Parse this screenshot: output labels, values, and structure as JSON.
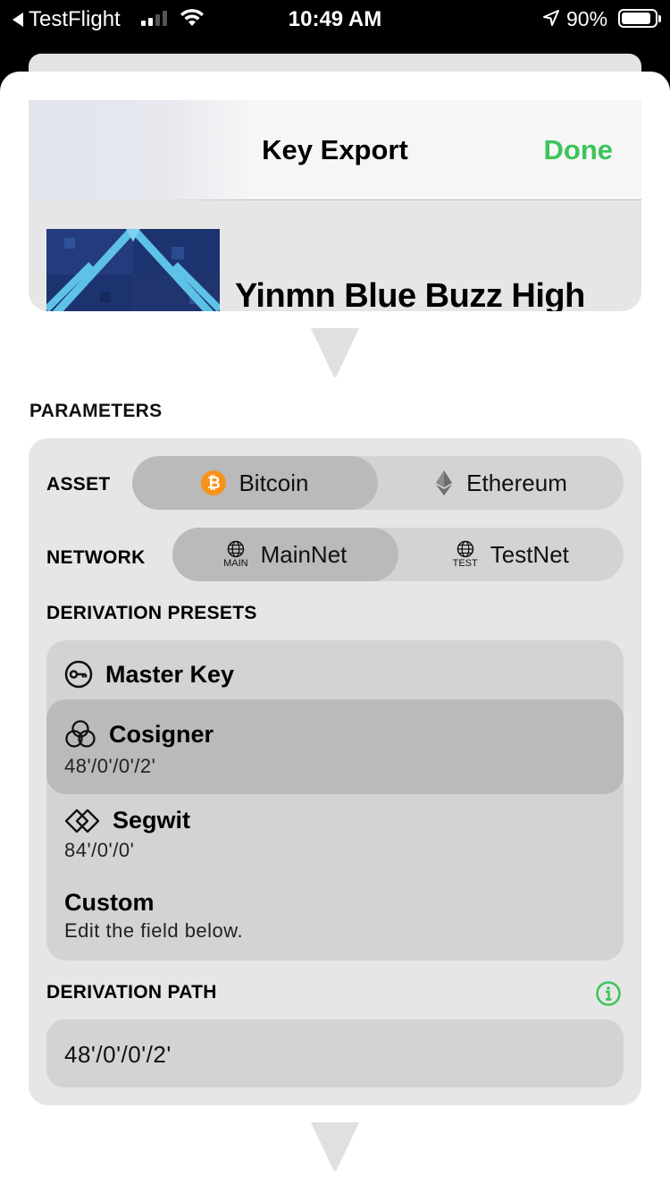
{
  "status_bar": {
    "back_app": "TestFlight",
    "time": "10:49 AM",
    "battery": "90%"
  },
  "nav": {
    "title": "Key Export",
    "done": "Done"
  },
  "key": {
    "name": "Yinmn Blue Buzz High"
  },
  "parameters": {
    "heading": "PARAMETERS",
    "asset": {
      "label": "ASSET",
      "options": [
        "Bitcoin",
        "Ethereum"
      ],
      "selected": "Bitcoin"
    },
    "network": {
      "label": "NETWORK",
      "options": [
        {
          "label": "MainNet",
          "caption": "MAIN"
        },
        {
          "label": "TestNet",
          "caption": "TEST"
        }
      ],
      "selected": "MainNet"
    },
    "presets": {
      "label": "DERIVATION PRESETS",
      "items": [
        {
          "title": "Master Key",
          "subtitle": "",
          "icon": "key-icon"
        },
        {
          "title": "Cosigner",
          "subtitle": "48'/0'/0'/2'",
          "icon": "cosigner-icon"
        },
        {
          "title": "Segwit",
          "subtitle": "84'/0'/0'",
          "icon": "segwit-icon"
        },
        {
          "title": "Custom",
          "subtitle": "Edit the field below.",
          "icon": ""
        }
      ],
      "selected": "Cosigner"
    },
    "path": {
      "label": "DERIVATION PATH",
      "value": "48'/0'/0'/2'"
    }
  },
  "colors": {
    "accent_green": "#3cc45a",
    "bitcoin_orange": "#f7931a",
    "card_bg": "#e6e6e6",
    "selected_bg": "#bababa"
  }
}
